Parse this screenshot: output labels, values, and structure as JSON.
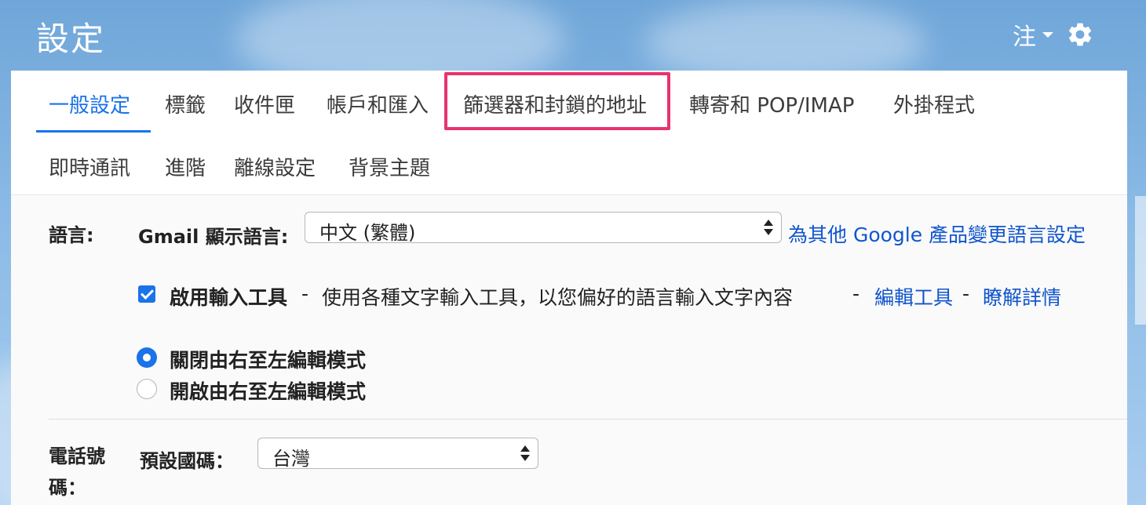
{
  "header": {
    "title": "設定",
    "account_label": "注"
  },
  "tabs": [
    {
      "label": "一般設定",
      "active": true
    },
    {
      "label": "標籤"
    },
    {
      "label": "收件匣"
    },
    {
      "label": "帳戶和匯入"
    },
    {
      "label": "篩選器和封鎖的地址",
      "highlighted": true
    },
    {
      "label": "轉寄和 POP/IMAP"
    },
    {
      "label": "外掛程式"
    },
    {
      "label": "即時通訊"
    },
    {
      "label": "進階"
    },
    {
      "label": "離線設定"
    },
    {
      "label": "背景主題"
    }
  ],
  "language": {
    "section_label": "語言:",
    "field_label": "Gmail 顯示語言:",
    "selected_value": "中文 (繁體)",
    "other_products_link": "為其他 Google 產品變更語言設定",
    "input_tools": {
      "checked": true,
      "bold_label": "啟用輸入工具",
      "separator": " - ",
      "description": "使用各種文字輸入工具，以您偏好的語言輸入文字內容",
      "edit_link": "編輯工具",
      "learn_more_link": "瞭解詳情"
    },
    "rtl_options": [
      {
        "label": "關閉由右至左編輯模式",
        "selected": true
      },
      {
        "label": "開啟由右至左編輯模式",
        "selected": false
      }
    ]
  },
  "phone": {
    "section_label_line1": "電話號",
    "section_label_line2": "碼：",
    "field_label": "預設國碼：",
    "selected_value": "台灣"
  },
  "colors": {
    "accent": "#1a73e8",
    "link": "#1155cc",
    "highlight": "#e8336f"
  }
}
